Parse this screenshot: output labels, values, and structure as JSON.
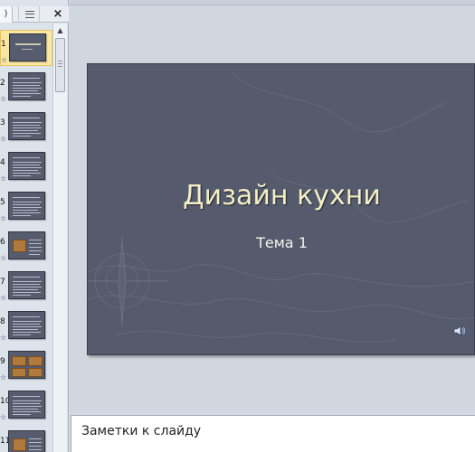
{
  "left_pane": {
    "slides_tab_label": ")",
    "outline_tab_icon": "outline-icon",
    "close_label": "×",
    "thumbnails": [
      {
        "number": "1",
        "kind": "title",
        "selected": true
      },
      {
        "number": "2",
        "kind": "text"
      },
      {
        "number": "3",
        "kind": "text"
      },
      {
        "number": "4",
        "kind": "text"
      },
      {
        "number": "5",
        "kind": "text"
      },
      {
        "number": "6",
        "kind": "picture-text"
      },
      {
        "number": "7",
        "kind": "text"
      },
      {
        "number": "8",
        "kind": "text"
      },
      {
        "number": "9",
        "kind": "pictures"
      },
      {
        "number": "10",
        "kind": "text"
      },
      {
        "number": "11",
        "kind": "picture-text"
      }
    ]
  },
  "slide": {
    "title": "Дизайн кухни",
    "subtitle": "Тема 1",
    "background_color": "#555a6c",
    "title_color": "#f3efc7",
    "sound_icon": "speaker-icon"
  },
  "notes": {
    "placeholder": "Заметки к слайду"
  }
}
